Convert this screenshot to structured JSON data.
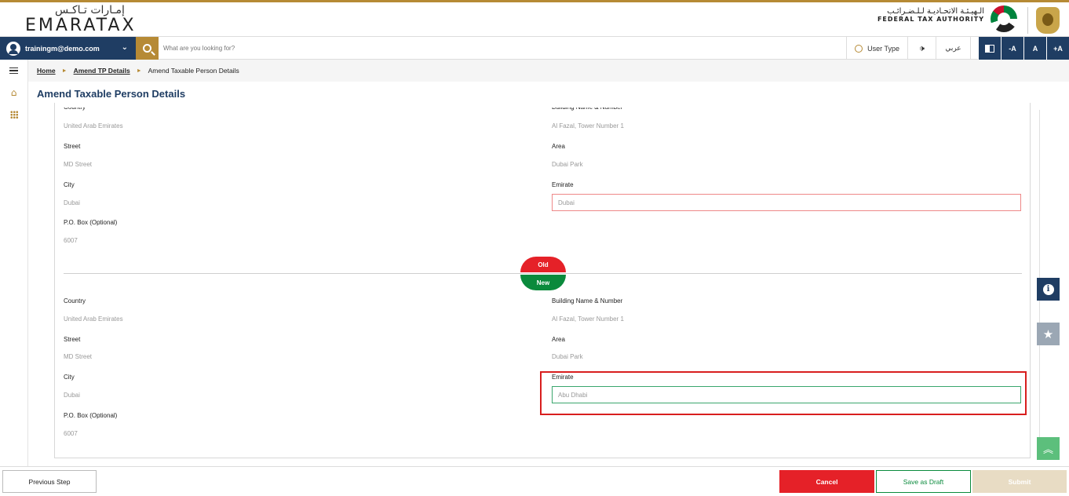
{
  "header": {
    "logo_ar": "إمـارات تـاكـس",
    "logo_en": "EMARATAX",
    "authority_ar": "الـهيـئـة الاتحـاديـة لـلـضـرائـب",
    "authority_en": "FEDERAL TAX AUTHORITY"
  },
  "navbar": {
    "user_email": "trainingm@demo.com",
    "search_placeholder": "What are you looking for?",
    "user_type_label": "User Type",
    "speaker_glyph": "🕩",
    "language_label": "عربي",
    "font_decrease": "-A",
    "font_normal": "A",
    "font_increase": "+A"
  },
  "breadcrumb": {
    "home": "Home",
    "amend_tp": "Amend TP Details",
    "current": "Amend Taxable Person Details",
    "separator": "►"
  },
  "page_title": "Amend Taxable Person Details",
  "old_section": {
    "country_label": "Country",
    "country_value": "United Arab Emirates",
    "building_label": "Building Name & Number",
    "building_value": "Al Fazal, Tower Number 1",
    "street_label": "Street",
    "street_value": "MD Street",
    "area_label": "Area",
    "area_value": "Dubai Park",
    "city_label": "City",
    "city_value": "Dubai",
    "emirate_label": "Emirate",
    "emirate_value": "Dubai",
    "pobox_label": "P.O. Box (Optional)",
    "pobox_value": "6007"
  },
  "compare": {
    "old_label": "Old",
    "new_label": "New",
    "old_color": "#e52128",
    "new_color": "#0a8a3c"
  },
  "new_section": {
    "country_label": "Country",
    "country_value": "United Arab Emirates",
    "building_label": "Building Name & Number",
    "building_value": "Al Fazal, Tower Number 1",
    "street_label": "Street",
    "street_value": "MD Street",
    "area_label": "Area",
    "area_value": "Dubai Park",
    "city_label": "City",
    "city_value": "Dubai",
    "emirate_label": "Emirate",
    "emirate_value": "Abu Dhabi",
    "pobox_label": "P.O. Box (Optional)",
    "pobox_value": "6007"
  },
  "side_buttons": {
    "info_glyph": "i",
    "star_glyph": "★",
    "top_glyph": "︽"
  },
  "footer": {
    "previous": "Previous Step",
    "cancel": "Cancel",
    "save_draft": "Save as Draft",
    "submit": "Submit"
  },
  "colors": {
    "brand_navy": "#1f3d63",
    "brand_gold": "#b68a35",
    "highlight_red": "#d81e1e"
  }
}
